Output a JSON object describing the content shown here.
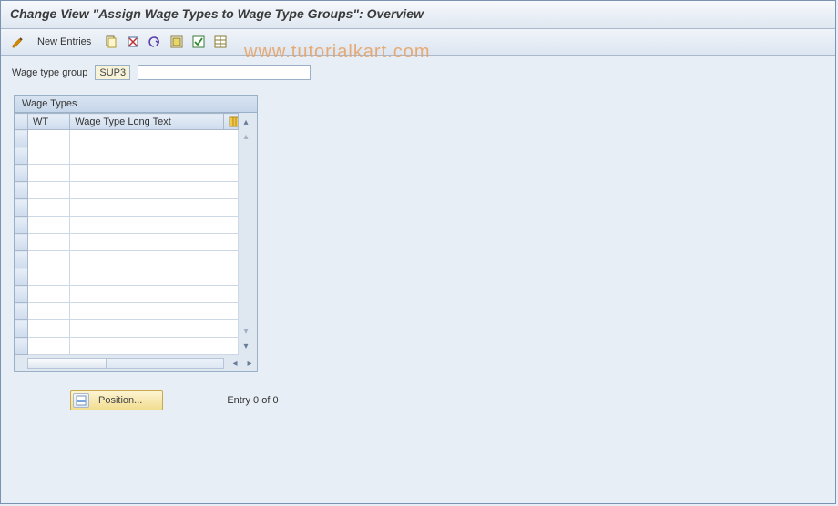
{
  "title": "Change View \"Assign Wage Types to Wage Type Groups\": Overview",
  "watermark": "www.tutorialkart.com",
  "toolbar": {
    "new_entries_label": "New Entries"
  },
  "filter": {
    "label": "Wage type group",
    "code": "SUP3",
    "description": ""
  },
  "table": {
    "title": "Wage Types",
    "columns": {
      "wt": "WT",
      "long_text": "Wage Type Long Text"
    },
    "rows": [
      {
        "wt": "",
        "text": ""
      },
      {
        "wt": "",
        "text": ""
      },
      {
        "wt": "",
        "text": ""
      },
      {
        "wt": "",
        "text": ""
      },
      {
        "wt": "",
        "text": ""
      },
      {
        "wt": "",
        "text": ""
      },
      {
        "wt": "",
        "text": ""
      },
      {
        "wt": "",
        "text": ""
      },
      {
        "wt": "",
        "text": ""
      },
      {
        "wt": "",
        "text": ""
      },
      {
        "wt": "",
        "text": ""
      },
      {
        "wt": "",
        "text": ""
      },
      {
        "wt": "",
        "text": ""
      }
    ]
  },
  "footer": {
    "position_label": "Position...",
    "entry_text": "Entry 0 of 0"
  }
}
